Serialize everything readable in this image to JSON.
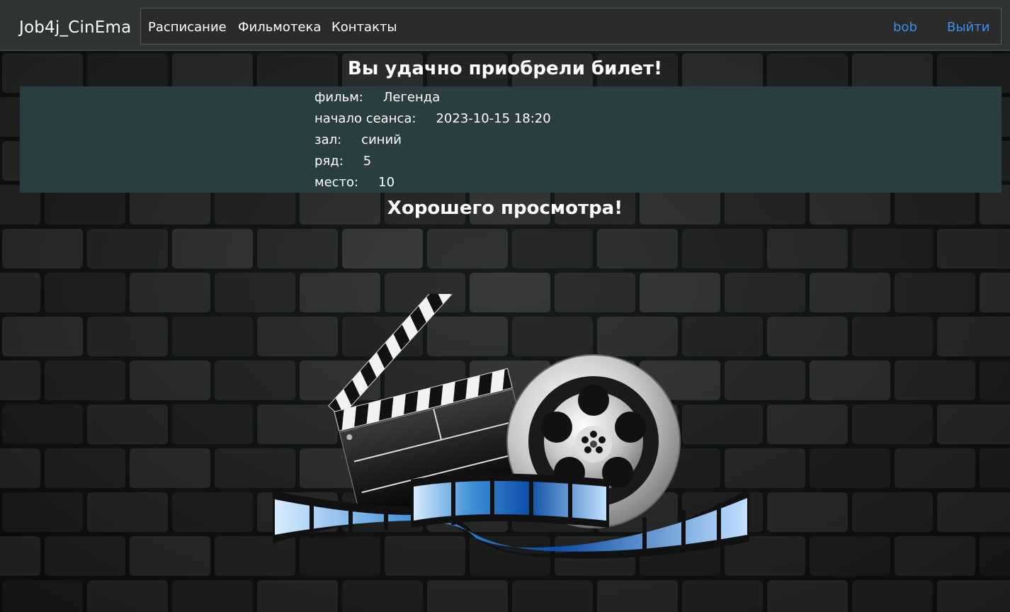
{
  "navbar": {
    "brand": "Job4j_CinEma",
    "links": [
      "Расписание",
      "Фильмотека",
      "Контакты"
    ],
    "user": "bob",
    "logout": "Выйти"
  },
  "main": {
    "heading": "Вы удачно приобрели билет!",
    "ticket": [
      {
        "label": "фильм:",
        "value": "Легенда"
      },
      {
        "label": "начало сеанса:",
        "value": "2023-10-15 18:20"
      },
      {
        "label": "зал:",
        "value": "синий"
      },
      {
        "label": "ряд:",
        "value": "5"
      },
      {
        "label": "место:",
        "value": "10"
      }
    ],
    "farewell": "Хорошего просмотра!"
  },
  "colors": {
    "navbar_bg": "#2f3432",
    "nav_box_bg": "#2b2b2b",
    "panel_bg": "#2a3d40",
    "link_accent": "#3b8ee8",
    "text": "#ffffff"
  },
  "icons": {
    "artwork": "clapperboard-film-reel-icon"
  }
}
